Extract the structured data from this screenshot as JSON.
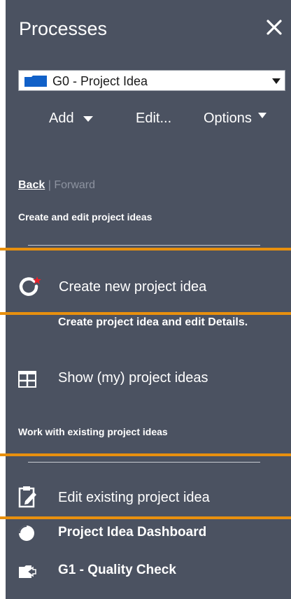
{
  "panel": {
    "title": "Processes",
    "close_icon": "close-icon"
  },
  "selector": {
    "icon": "folder-icon",
    "value": "G0 - Project Idea",
    "dropdown_icon": "caret-down-icon"
  },
  "toolbar": {
    "add_label": "Add",
    "edit_label": "Edit...",
    "options_label": "Options"
  },
  "nav": {
    "back_label": "Back",
    "separator": "|",
    "forward_label": "Forward"
  },
  "sections": {
    "create_heading": "Create and edit project ideas",
    "existing_heading": "Work with existing project ideas"
  },
  "menu": {
    "create_new": "Create new project idea",
    "create_desc": "Create project idea and edit Details.",
    "show_my": "Show (my) project ideas",
    "edit_existing": "Edit existing project idea",
    "dashboard": "Project Idea Dashboard",
    "quality_check": "G1 - Quality Check"
  },
  "colors": {
    "panel_background": "#4b5261",
    "highlight_orange": "#e8900e",
    "folder_blue": "#1060c8",
    "new_badge_red": "#e8202a"
  }
}
